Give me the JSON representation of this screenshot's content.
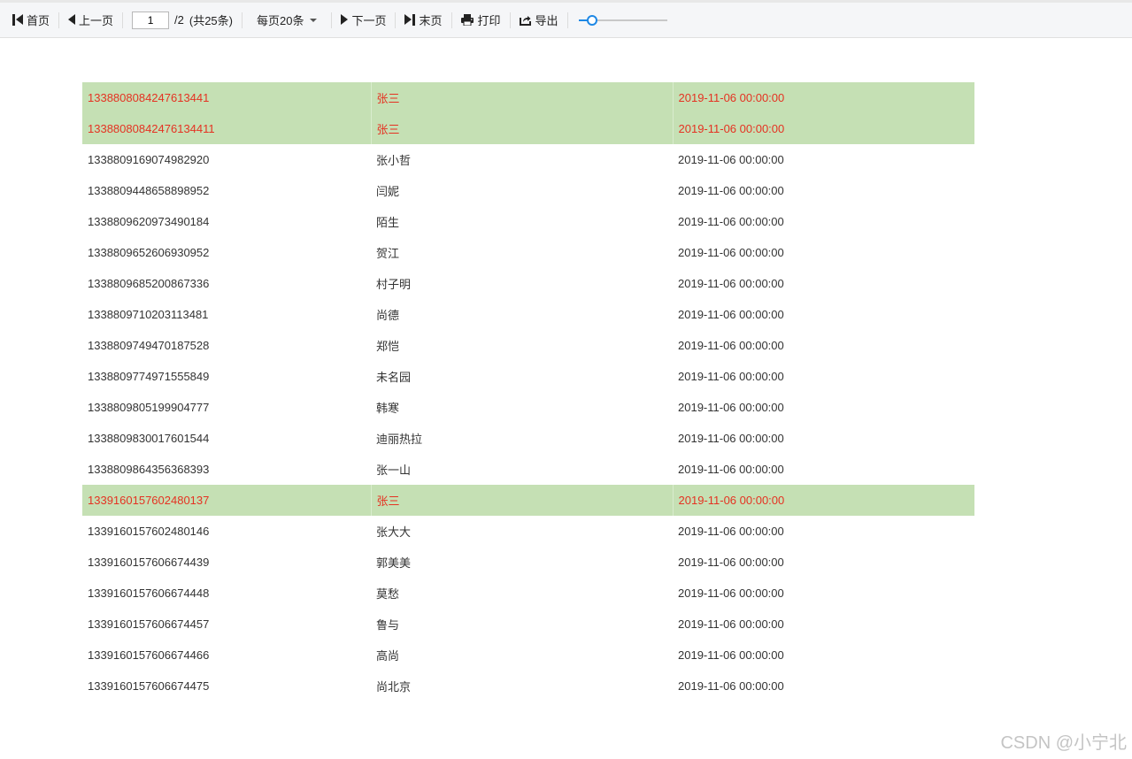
{
  "toolbar": {
    "first_label": "首页",
    "prev_label": "上一页",
    "page_value": "1",
    "page_total": "/2",
    "record_count": "(共25条)",
    "page_size_label": "每页20条",
    "next_label": "下一页",
    "last_label": "末页",
    "print_label": "打印",
    "export_label": "导出",
    "zoom_level": 0.15
  },
  "colors": {
    "highlight_bg": "#c5e0b4",
    "highlight_text": "#e53222",
    "accent": "#1e88e5"
  },
  "rows": [
    {
      "id": "1338808084247613441",
      "name": "张三",
      "date": "2019-11-06 00:00:00",
      "highlighted": true
    },
    {
      "id": "13388080842476134411",
      "name": "张三",
      "date": "2019-11-06 00:00:00",
      "highlighted": true
    },
    {
      "id": "1338809169074982920",
      "name": "张小哲",
      "date": "2019-11-06 00:00:00",
      "highlighted": false
    },
    {
      "id": "1338809448658898952",
      "name": "闫妮",
      "date": "2019-11-06 00:00:00",
      "highlighted": false
    },
    {
      "id": "1338809620973490184",
      "name": "陌生",
      "date": "2019-11-06 00:00:00",
      "highlighted": false
    },
    {
      "id": "1338809652606930952",
      "name": "贺江",
      "date": "2019-11-06 00:00:00",
      "highlighted": false
    },
    {
      "id": "1338809685200867336",
      "name": "村子明",
      "date": "2019-11-06 00:00:00",
      "highlighted": false
    },
    {
      "id": "1338809710203113481",
      "name": "尚德",
      "date": "2019-11-06 00:00:00",
      "highlighted": false
    },
    {
      "id": "1338809749470187528",
      "name": "郑恺",
      "date": "2019-11-06 00:00:00",
      "highlighted": false
    },
    {
      "id": "1338809774971555849",
      "name": "未名园",
      "date": "2019-11-06 00:00:00",
      "highlighted": false
    },
    {
      "id": "1338809805199904777",
      "name": "韩寒",
      "date": "2019-11-06 00:00:00",
      "highlighted": false
    },
    {
      "id": "1338809830017601544",
      "name": "迪丽热拉",
      "date": "2019-11-06 00:00:00",
      "highlighted": false
    },
    {
      "id": "1338809864356368393",
      "name": "张一山",
      "date": "2019-11-06 00:00:00",
      "highlighted": false
    },
    {
      "id": "1339160157602480137",
      "name": "张三",
      "date": "2019-11-06 00:00:00",
      "highlighted": true
    },
    {
      "id": "1339160157602480146",
      "name": "张大大",
      "date": "2019-11-06 00:00:00",
      "highlighted": false
    },
    {
      "id": "1339160157606674439",
      "name": "郭美美",
      "date": "2019-11-06 00:00:00",
      "highlighted": false
    },
    {
      "id": "1339160157606674448",
      "name": "莫愁",
      "date": "2019-11-06 00:00:00",
      "highlighted": false
    },
    {
      "id": "1339160157606674457",
      "name": "鲁与",
      "date": "2019-11-06 00:00:00",
      "highlighted": false
    },
    {
      "id": "1339160157606674466",
      "name": "高尚",
      "date": "2019-11-06 00:00:00",
      "highlighted": false
    },
    {
      "id": "1339160157606674475",
      "name": "尚北京",
      "date": "2019-11-06 00:00:00",
      "highlighted": false
    }
  ],
  "watermark": "CSDN @小宁北"
}
